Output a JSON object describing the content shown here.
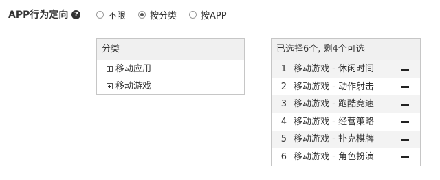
{
  "header": {
    "label": "APP行为定向",
    "help_icon": "?"
  },
  "radio_options": [
    {
      "label": "不限",
      "checked": false
    },
    {
      "label": "按分类",
      "checked": true
    },
    {
      "label": "按APP",
      "checked": false
    }
  ],
  "category_panel": {
    "title": "分类",
    "items": [
      {
        "label": "移动应用"
      },
      {
        "label": "移动游戏"
      }
    ]
  },
  "selected_panel": {
    "title": "已选择6个, 剩4个可选",
    "items": [
      {
        "index": "1",
        "label": "移动游戏 - 休闲时间"
      },
      {
        "index": "2",
        "label": "移动游戏 - 动作射击"
      },
      {
        "index": "3",
        "label": "移动游戏 - 跑酷竞速"
      },
      {
        "index": "4",
        "label": "移动游戏 - 经营策略"
      },
      {
        "index": "5",
        "label": "移动游戏 - 扑克棋牌"
      },
      {
        "index": "6",
        "label": "移动游戏 - 角色扮演"
      }
    ]
  }
}
